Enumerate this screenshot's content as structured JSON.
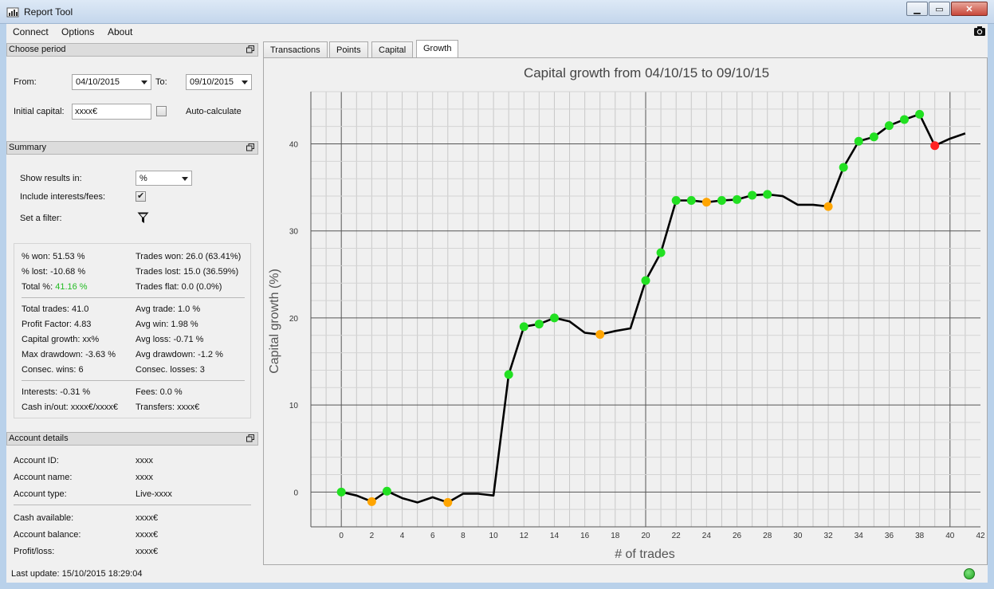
{
  "window": {
    "title": "Report Tool"
  },
  "menu": {
    "connect": "Connect",
    "options": "Options",
    "about": "About"
  },
  "period": {
    "header": "Choose period",
    "from_label": "From:",
    "from_value": "04/10/2015",
    "to_label": "To:",
    "to_value": "09/10/2015",
    "capital_label": "Initial capital:",
    "capital_value": "xxxx€",
    "autocalc_label": "Auto-calculate"
  },
  "summary": {
    "header": "Summary",
    "show_results_label": "Show results in:",
    "show_results_value": "%",
    "include_label": "Include interests/fees:",
    "filter_label": "Set a filter:",
    "stats": {
      "won_pct": "% won: 51.53 %",
      "lost_pct": "% lost: -10.68 %",
      "total_pct_label": "Total %:",
      "total_pct_value": "41.16 %",
      "trades_won": "Trades won: 26.0 (63.41%)",
      "trades_lost": "Trades lost: 15.0 (36.59%)",
      "trades_flat": "Trades flat: 0.0 (0.0%)",
      "total_trades": "Total trades: 41.0",
      "profit_factor": "Profit Factor: 4.83",
      "capital_growth": "Capital growth: xx%",
      "max_drawdown": "Max drawdown: -3.63 %",
      "consec_wins": "Consec. wins: 6",
      "avg_trade": "Avg trade: 1.0 %",
      "avg_win": "Avg win: 1.98 %",
      "avg_loss": "Avg loss: -0.71 %",
      "avg_drawdown": "Avg drawdown: -1.2 %",
      "consec_losses": "Consec. losses: 3",
      "interests": "Interests: -0.31 %",
      "cash_inout": "Cash in/out: xxxx€/xxxx€",
      "fees": "Fees: 0.0 %",
      "transfers": "Transfers: xxxx€"
    }
  },
  "account": {
    "header": "Account details",
    "id_label": "Account ID:",
    "id_value": "xxxx",
    "name_label": "Account name:",
    "name_value": "xxxx",
    "type_label": "Account type:",
    "type_value": "Live-xxxx",
    "cash_label": "Cash available:",
    "cash_value": "xxxx€",
    "balance_label": "Account balance:",
    "balance_value": "xxxx€",
    "pl_label": "Profit/loss:",
    "pl_value": "xxxx€"
  },
  "tabs": [
    "Transactions",
    "Points",
    "Capital",
    "Growth"
  ],
  "status": {
    "last_update": "Last update: 15/10/2015 18:29:04"
  },
  "colors": {
    "win": "#22e022",
    "flat": "#ffa500",
    "loss": "#ff2020",
    "line": "#000000"
  },
  "chart_data": {
    "type": "line",
    "title": "Capital growth from 04/10/15 to 09/10/15",
    "xlabel": "# of trades",
    "ylabel": "Capital growth (%)",
    "xlim": [
      -2,
      42
    ],
    "ylim": [
      -4,
      46
    ],
    "xticks": [
      0,
      2,
      4,
      6,
      8,
      10,
      12,
      14,
      16,
      18,
      20,
      22,
      24,
      26,
      28,
      30,
      32,
      34,
      36,
      38,
      40,
      42
    ],
    "yticks": [
      0,
      10,
      20,
      30,
      40
    ],
    "x": [
      0,
      1,
      2,
      3,
      4,
      5,
      6,
      7,
      8,
      9,
      10,
      11,
      12,
      13,
      14,
      15,
      16,
      17,
      18,
      19,
      20,
      21,
      22,
      23,
      24,
      25,
      26,
      27,
      28,
      29,
      30,
      31,
      32,
      33,
      34,
      35,
      36,
      37,
      38,
      39,
      40,
      41
    ],
    "y": [
      0,
      -0.4,
      -1.1,
      0.1,
      -0.7,
      -1.2,
      -0.6,
      -1.2,
      -0.2,
      -0.2,
      -0.4,
      13.5,
      19.0,
      19.3,
      20.0,
      19.6,
      18.3,
      18.1,
      18.5,
      18.8,
      24.3,
      27.5,
      33.5,
      33.5,
      33.3,
      33.5,
      33.6,
      34.1,
      34.2,
      34.0,
      33.0,
      33.0,
      32.8,
      37.3,
      40.3,
      40.8,
      42.1,
      42.8,
      43.4,
      39.8,
      40.6,
      41.2
    ],
    "markers": [
      {
        "x": 0,
        "y": 0,
        "kind": "win"
      },
      {
        "x": 2,
        "y": -1.1,
        "kind": "flat"
      },
      {
        "x": 3,
        "y": 0.1,
        "kind": "win"
      },
      {
        "x": 7,
        "y": -1.2,
        "kind": "flat"
      },
      {
        "x": 11,
        "y": 13.5,
        "kind": "win"
      },
      {
        "x": 12,
        "y": 19.0,
        "kind": "win"
      },
      {
        "x": 13,
        "y": 19.3,
        "kind": "win"
      },
      {
        "x": 14,
        "y": 20.0,
        "kind": "win"
      },
      {
        "x": 17,
        "y": 18.1,
        "kind": "flat"
      },
      {
        "x": 20,
        "y": 24.3,
        "kind": "win"
      },
      {
        "x": 21,
        "y": 27.5,
        "kind": "win"
      },
      {
        "x": 22,
        "y": 33.5,
        "kind": "win"
      },
      {
        "x": 23,
        "y": 33.5,
        "kind": "win"
      },
      {
        "x": 24,
        "y": 33.3,
        "kind": "flat"
      },
      {
        "x": 25,
        "y": 33.5,
        "kind": "win"
      },
      {
        "x": 26,
        "y": 33.6,
        "kind": "win"
      },
      {
        "x": 27,
        "y": 34.1,
        "kind": "win"
      },
      {
        "x": 28,
        "y": 34.2,
        "kind": "win"
      },
      {
        "x": 32,
        "y": 32.8,
        "kind": "flat"
      },
      {
        "x": 33,
        "y": 37.3,
        "kind": "win"
      },
      {
        "x": 34,
        "y": 40.3,
        "kind": "win"
      },
      {
        "x": 35,
        "y": 40.8,
        "kind": "win"
      },
      {
        "x": 36,
        "y": 42.1,
        "kind": "win"
      },
      {
        "x": 37,
        "y": 42.8,
        "kind": "win"
      },
      {
        "x": 38,
        "y": 43.4,
        "kind": "win"
      },
      {
        "x": 39,
        "y": 39.8,
        "kind": "loss"
      }
    ],
    "grid": true
  }
}
